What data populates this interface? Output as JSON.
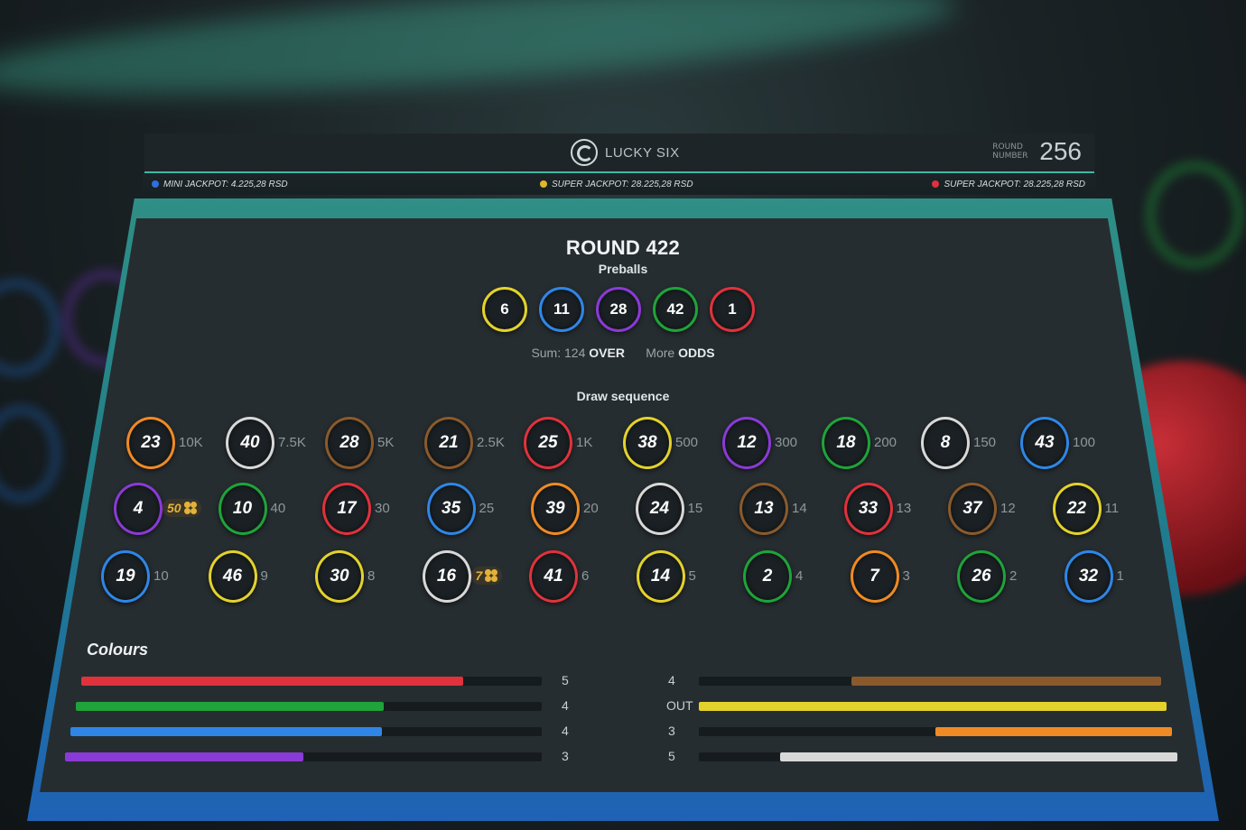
{
  "header": {
    "logo_text": "LUCKY SIX",
    "round_number_label": "ROUND NUMBER",
    "round_number": "256"
  },
  "jackpots": [
    {
      "label": "MINI JACKPOT: 4.225,28 RSD",
      "color": "#2f6fe0"
    },
    {
      "label": "SUPER JACKPOT: 28.225,28 RSD",
      "color": "#e0b62a"
    },
    {
      "label": "SUPER JACKPOT: 28.225,28 RSD",
      "color": "#e0323c"
    }
  ],
  "results": {
    "round_title": "ROUND 422",
    "preballs_label": "Preballs",
    "preballs": [
      {
        "number": "6",
        "color": "#e3d22c"
      },
      {
        "number": "11",
        "color": "#2f86e6"
      },
      {
        "number": "28",
        "color": "#8a3ad6"
      },
      {
        "number": "42",
        "color": "#1fa33a"
      },
      {
        "number": "1",
        "color": "#e0323c"
      }
    ],
    "sum_label": "Sum: 124",
    "sum_result": "OVER",
    "more_label": "More",
    "more_result": "ODDS",
    "draw_sequence_label": "Draw sequence",
    "draw_sequence": [
      {
        "number": "23",
        "color": "#f08a24",
        "odd": "10K"
      },
      {
        "number": "40",
        "color": "#d8d8d8",
        "odd": "7.5K"
      },
      {
        "number": "28",
        "color": "#8a5a2c",
        "odd": "5K"
      },
      {
        "number": "21",
        "color": "#8a5a2c",
        "odd": "2.5K"
      },
      {
        "number": "25",
        "color": "#e0323c",
        "odd": "1K"
      },
      {
        "number": "38",
        "color": "#e3d22c",
        "odd": "500"
      },
      {
        "number": "12",
        "color": "#8a3ad6",
        "odd": "300"
      },
      {
        "number": "18",
        "color": "#1fa33a",
        "odd": "200"
      },
      {
        "number": "8",
        "color": "#d8d8d8",
        "odd": "150"
      },
      {
        "number": "43",
        "color": "#2f86e6",
        "odd": "100"
      },
      {
        "number": "4",
        "color": "#8a3ad6",
        "odd": "50",
        "bonus": true
      },
      {
        "number": "10",
        "color": "#1fa33a",
        "odd": "40"
      },
      {
        "number": "17",
        "color": "#e0323c",
        "odd": "30"
      },
      {
        "number": "35",
        "color": "#2f86e6",
        "odd": "25"
      },
      {
        "number": "39",
        "color": "#f08a24",
        "odd": "20"
      },
      {
        "number": "24",
        "color": "#d8d8d8",
        "odd": "15"
      },
      {
        "number": "13",
        "color": "#8a5a2c",
        "odd": "14"
      },
      {
        "number": "33",
        "color": "#e0323c",
        "odd": "13"
      },
      {
        "number": "37",
        "color": "#8a5a2c",
        "odd": "12"
      },
      {
        "number": "22",
        "color": "#e3d22c",
        "odd": "11"
      },
      {
        "number": "19",
        "color": "#2f86e6",
        "odd": "10"
      },
      {
        "number": "46",
        "color": "#e3d22c",
        "odd": "9"
      },
      {
        "number": "30",
        "color": "#e3d22c",
        "odd": "8"
      },
      {
        "number": "16",
        "color": "#d8d8d8",
        "odd": "7",
        "bonus": true
      },
      {
        "number": "41",
        "color": "#e0323c",
        "odd": "6"
      },
      {
        "number": "14",
        "color": "#e3d22c",
        "odd": "5"
      },
      {
        "number": "2",
        "color": "#1fa33a",
        "odd": "4"
      },
      {
        "number": "7",
        "color": "#f08a24",
        "odd": "3"
      },
      {
        "number": "26",
        "color": "#1fa33a",
        "odd": "2"
      },
      {
        "number": "32",
        "color": "#2f86e6",
        "odd": "1"
      }
    ],
    "colours_label": "Colours",
    "colours": [
      {
        "color": "#e0323c",
        "count": "5",
        "fill": 0.83
      },
      {
        "color": "#1fa33a",
        "count": "4",
        "fill": 0.66
      },
      {
        "color": "#2f86e6",
        "count": "4",
        "fill": 0.66
      },
      {
        "color": "#8a3ad6",
        "count": "3",
        "fill": 0.5
      },
      {
        "color": "#8a5a2c",
        "count": "4",
        "fill": 0.67
      },
      {
        "color": "#e3d22c",
        "count": "OUT",
        "fill": 1.0
      },
      {
        "color": "#f08a24",
        "count": "3",
        "fill": 0.5
      },
      {
        "color": "#d8d8d8",
        "count": "5",
        "fill": 0.83
      }
    ]
  }
}
